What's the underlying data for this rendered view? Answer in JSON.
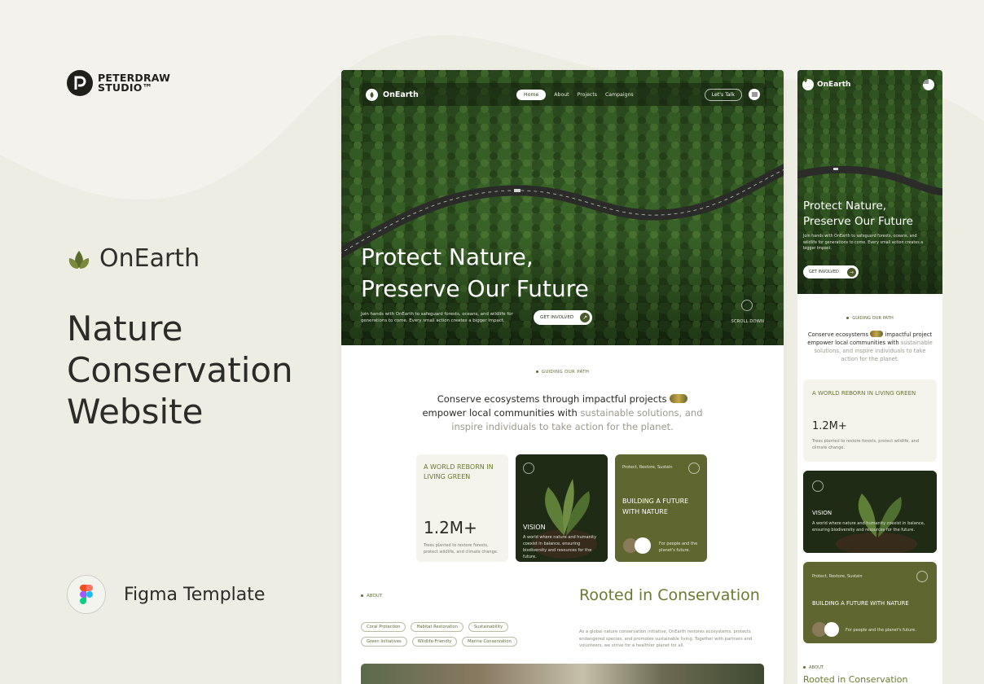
{
  "studio": {
    "line1": "PETERDRAW",
    "line2": "STUDIO™"
  },
  "product_name": "OnEarth",
  "headline": {
    "line1": "Nature",
    "line2": "Conservation",
    "line3": "Website"
  },
  "figma_label": "Figma Template",
  "colors": {
    "accent": "#5f6630",
    "accent_text": "#6b7a30",
    "background": "#eeede4"
  },
  "desktop": {
    "nav": {
      "logo": "OnEarth",
      "links": [
        "Home",
        "About",
        "Projects",
        "Campaigns"
      ],
      "cta": "Let's Talk"
    },
    "hero": {
      "title_line1": "Protect Nature,",
      "title_line2": "Preserve Our Future",
      "description": "Join hands with OnEarth to safeguard forests, oceans, and wildlife for generations to come. Every small action creates a bigger impact.",
      "cta": "GET INVOLVED",
      "scroll": "SCROLL DOWN"
    },
    "guiding_tag": "GUIDING OUR PATH",
    "mission": {
      "part1": "Conserve ecosystems through impactful projects",
      "part2": "empower local communities with",
      "muted": "sustainable solutions, and inspire individuals to take action for the planet."
    },
    "cards": {
      "stat_title": "A WORLD REBORN IN LIVING GREEN",
      "stat_value": "1.2M+",
      "stat_desc": "Trees planted to restore forests, protect wildlife, and climate change.",
      "vision_title": "VISION",
      "vision_desc": "A world where nature and humanity coexist in balance, ensuring biodiversity and resources for the future.",
      "build_tag": "Protect, Restore, Sustain",
      "build_title": "BUILDING A FUTURE WITH NATURE",
      "build_desc": "For people and the planet's future."
    },
    "about_tag": "ABOUT",
    "rooted_title": "Rooted in Conservation",
    "tags": [
      "Coral Protection",
      "Habitat Restoration",
      "Sustainability",
      "Green Initiatives",
      "Wildlife-Friendly",
      "Marine Conservation"
    ],
    "about_desc": "As a global nature conservation initiative, OnEarth restores ecosystems, protects endangered species, and promotes sustainable living. Together with partners and volunteers, we strive for a healthier planet for all."
  },
  "mobile": {
    "logo": "OnEarth",
    "title_line1": "Protect Nature,",
    "title_line2": "Preserve Our Future",
    "description": "Join hands with OnEarth to safeguard forests, oceans, and wildlife for generations to come. Every small action creates a bigger impact.",
    "cta": "GET INVOLVED",
    "guiding_tag": "GUIDING OUR PATH",
    "mission_part1": "Conserve ecosystems",
    "mission_part2": "impactful project empower local communities with",
    "mission_muted": "sustainable solutions, and inspire individuals to take action for the planet.",
    "stat_title": "A WORLD REBORN IN LIVING GREEN",
    "stat_value": "1.2M+",
    "stat_desc": "Trees planted to restore forests, protect wildlife, and climate change.",
    "vision_title": "VISION",
    "vision_desc": "A world where nature and humanity coexist in balance, ensuring biodiversity and resources for the future.",
    "build_tag": "Protect, Restore, Sustain",
    "build_title": "BUILDING A FUTURE WITH NATURE",
    "build_desc": "For people and the planet's future.",
    "about_tag": "ABOUT",
    "rooted_title": "Rooted in Conservation"
  }
}
